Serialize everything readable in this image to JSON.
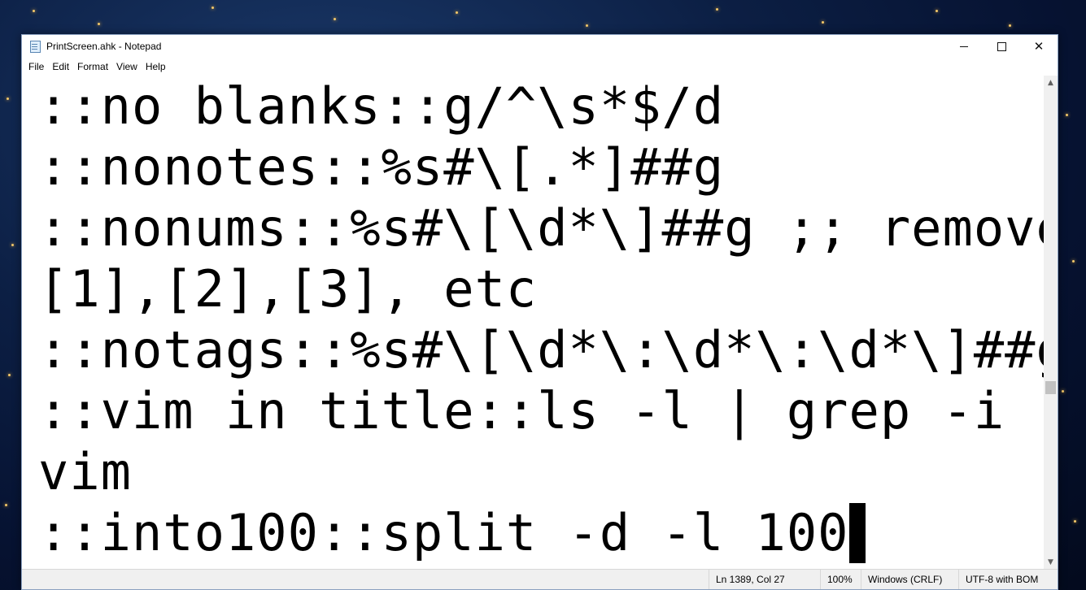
{
  "window": {
    "title": "PrintScreen.ahk - Notepad",
    "app_icon": "notepad-icon",
    "controls": {
      "minimize": "minimize-icon",
      "maximize": "maximize-icon",
      "close": "close-icon",
      "close_glyph": "✕"
    }
  },
  "menu": [
    "File",
    "Edit",
    "Format",
    "View",
    "Help"
  ],
  "editor": {
    "lines": [
      "::no blanks::g/^\\s*$/d",
      "::nonotes::%s#\\[.*]##g",
      "::nonums::%s#\\[\\d*\\]##g ;; remove",
      "[1],[2],[3], etc",
      "::notags::%s#\\[\\d*\\:\\d*\\:\\d*\\]##g",
      "::vim in title::ls -l | grep -i",
      "vim",
      "::into100::split -d -l 100"
    ]
  },
  "scrollbar": {
    "up": "▲",
    "down": "▼"
  },
  "status": {
    "position": "Ln 1389, Col 27",
    "zoom": "100%",
    "line_ending": "Windows (CRLF)",
    "encoding": "UTF-8 with BOM"
  },
  "colors": {
    "accent_bg": "#0c1f44",
    "window_border": "#8aa0c0"
  }
}
